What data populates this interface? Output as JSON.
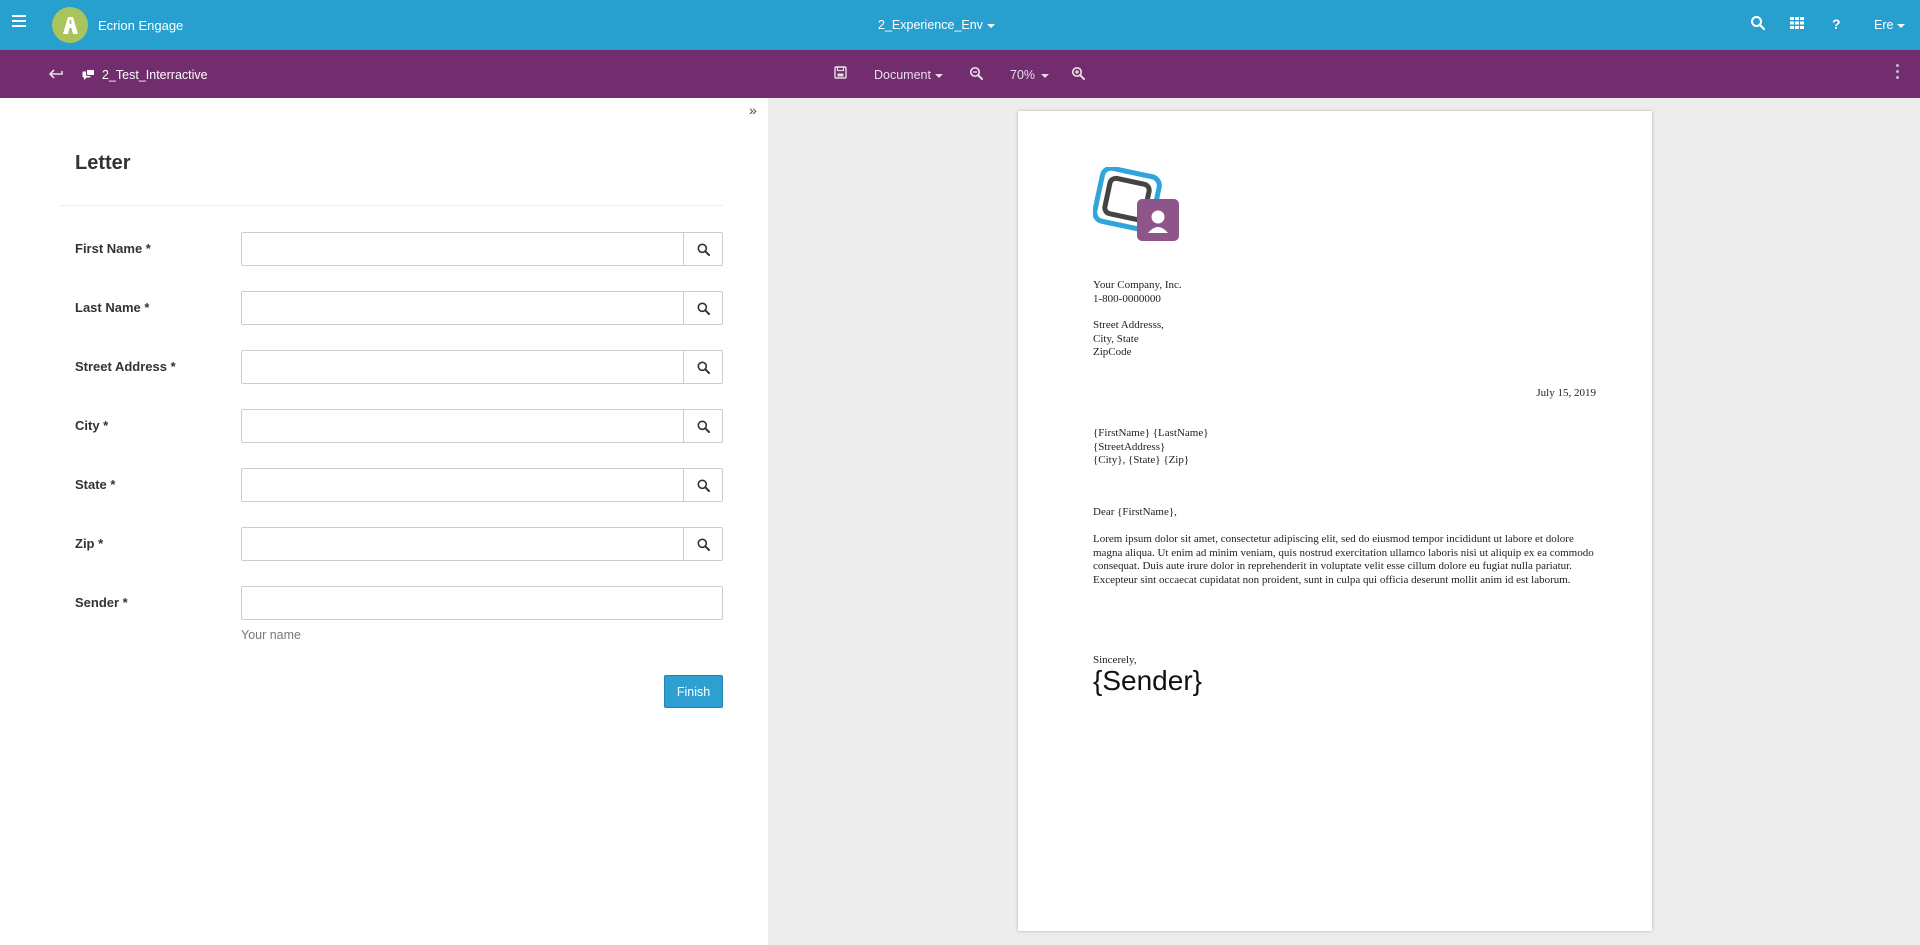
{
  "app": {
    "brand_name": "Ecrion Engage",
    "environment": "2_Experience_Env",
    "user": "Ere",
    "colors": {
      "topbar": "#28a0cf",
      "subbar": "#722d6e",
      "accent": "#2d9fd0"
    }
  },
  "topbar_icons": [
    "menu-icon",
    "search-icon",
    "grid-icon",
    "help-icon"
  ],
  "toolbar": {
    "document_title": "2_Test_Interractive",
    "view_mode": "Document",
    "zoom": "70%"
  },
  "form": {
    "title": "Letter",
    "fields": [
      {
        "label": "First Name *",
        "value": "",
        "has_lookup": true
      },
      {
        "label": "Last Name *",
        "value": "",
        "has_lookup": true
      },
      {
        "label": "Street Address *",
        "value": "",
        "has_lookup": true
      },
      {
        "label": "City *",
        "value": "",
        "has_lookup": true
      },
      {
        "label": "State *",
        "value": "",
        "has_lookup": true
      },
      {
        "label": "Zip *",
        "value": "",
        "has_lookup": true
      },
      {
        "label": "Sender *",
        "value": "",
        "has_lookup": false,
        "help": "Your name"
      }
    ],
    "finish_label": "Finish"
  },
  "letter": {
    "company_lines": [
      "Your Company, Inc.",
      "1-800-0000000"
    ],
    "address_lines": [
      "Street Addresss,",
      "City, State",
      "ZipCode"
    ],
    "date": "July 15, 2019",
    "recipient_lines": [
      "{FirstName} {LastName}",
      "{StreetAddress}",
      "{City}, {State} {Zip}"
    ],
    "salutation": "Dear {FirstName},",
    "body": "Lorem ipsum dolor sit amet, consectetur adipiscing elit, sed do eiusmod tempor incididunt ut labore et dolore magna aliqua. Ut enim ad minim veniam, quis nostrud exercitation ullamco laboris nisi ut aliquip ex ea commodo consequat. Duis aute irure dolor in reprehenderit in voluptate velit esse cillum dolore eu fugiat nulla pariatur. Excepteur sint occaecat cupidatat non proident, sunt in culpa qui officia deserunt mollit anim id est laborum.",
    "closing": "Sincerely,",
    "sender": "{Sender}"
  }
}
